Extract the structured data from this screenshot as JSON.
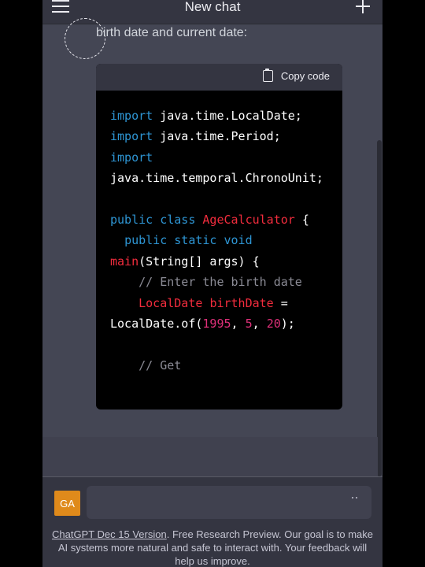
{
  "header": {
    "title": "New chat",
    "menu_icon": "hamburger-menu-icon",
    "new_chat_icon": "plus-icon"
  },
  "message": {
    "text": "birth date and current date:"
  },
  "code_block": {
    "copy_label": "Copy code",
    "copy_icon": "clipboard-icon",
    "lines": [
      [
        {
          "t": "import",
          "c": "kw"
        },
        {
          "t": " java.time.LocalDate;",
          "c": ""
        }
      ],
      [
        {
          "t": "import",
          "c": "kw"
        },
        {
          "t": " java.time.Period;",
          "c": ""
        }
      ],
      [
        {
          "t": "import",
          "c": "kw"
        }
      ],
      [
        {
          "t": "java.time.temporal.ChronoUnit;",
          "c": ""
        }
      ],
      [],
      [
        {
          "t": "public",
          "c": "kw"
        },
        {
          "t": " ",
          "c": ""
        },
        {
          "t": "class",
          "c": "kw"
        },
        {
          "t": " ",
          "c": ""
        },
        {
          "t": "AgeCalculator",
          "c": "cls"
        },
        {
          "t": " {",
          "c": ""
        }
      ],
      [
        {
          "t": "  ",
          "c": ""
        },
        {
          "t": "public",
          "c": "kw"
        },
        {
          "t": " ",
          "c": ""
        },
        {
          "t": "static",
          "c": "kw"
        },
        {
          "t": " ",
          "c": ""
        },
        {
          "t": "void",
          "c": "kw"
        }
      ],
      [
        {
          "t": "main",
          "c": "cls"
        },
        {
          "t": "(String[] args) {",
          "c": ""
        }
      ],
      [
        {
          "t": "    ",
          "c": ""
        },
        {
          "t": "// Enter the birth date",
          "c": "cm"
        }
      ],
      [
        {
          "t": "    ",
          "c": ""
        },
        {
          "t": "LocalDate",
          "c": "cls"
        },
        {
          "t": " ",
          "c": ""
        },
        {
          "t": "birthDate",
          "c": "cls"
        },
        {
          "t": " =",
          "c": ""
        }
      ],
      [
        {
          "t": "LocalDate.of(",
          "c": ""
        },
        {
          "t": "1995",
          "c": "num"
        },
        {
          "t": ", ",
          "c": ""
        },
        {
          "t": "5",
          "c": "num"
        },
        {
          "t": ", ",
          "c": ""
        },
        {
          "t": "20",
          "c": "num"
        },
        {
          "t": ");",
          "c": ""
        }
      ],
      [],
      [
        {
          "t": "    ",
          "c": ""
        },
        {
          "t": "// Get",
          "c": "cm"
        }
      ]
    ]
  },
  "composer": {
    "avatar_initials": "GA",
    "typing_indicator_icon": "dots-icon"
  },
  "footer": {
    "version_link": "ChatGPT Dec 15 Version",
    "note": ". Free Research Preview. Our goal is to make AI systems more natural and safe to interact with. Your feedback will help us improve."
  }
}
